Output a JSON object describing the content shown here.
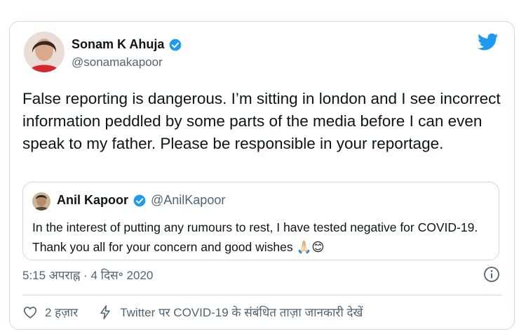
{
  "author": {
    "display_name": "Sonam K Ahuja",
    "handle": "@sonamakapoor",
    "verified": true
  },
  "tweet_text": "False reporting is dangerous. I’m sitting in london and I see incorrect information peddled by some parts of the media before I can even speak to my father. Please be responsible in your reportage.",
  "quoted_tweet": {
    "display_name": "Anil Kapoor",
    "handle": "@AnilKapoor",
    "verified": true,
    "text": "In the interest of putting any rumours to rest, I have tested negative for COVID-19. Thank you all for your concern and good wishes 🙏🏻😊"
  },
  "timestamp": "5:15 अपराह्न · 4 दिस॰ 2020",
  "actions": {
    "likes": "2 हज़ार",
    "covid_info": "Twitter पर COVID-19 के संबंधित ताज़ा जानकारी देखें"
  },
  "colors": {
    "twitter_blue": "#1d9bf0",
    "secondary_text": "#536471",
    "border": "#cfd9de"
  },
  "icons": [
    "twitter-bird-icon",
    "verified-badge-icon",
    "info-icon",
    "heart-icon",
    "lightning-icon"
  ]
}
